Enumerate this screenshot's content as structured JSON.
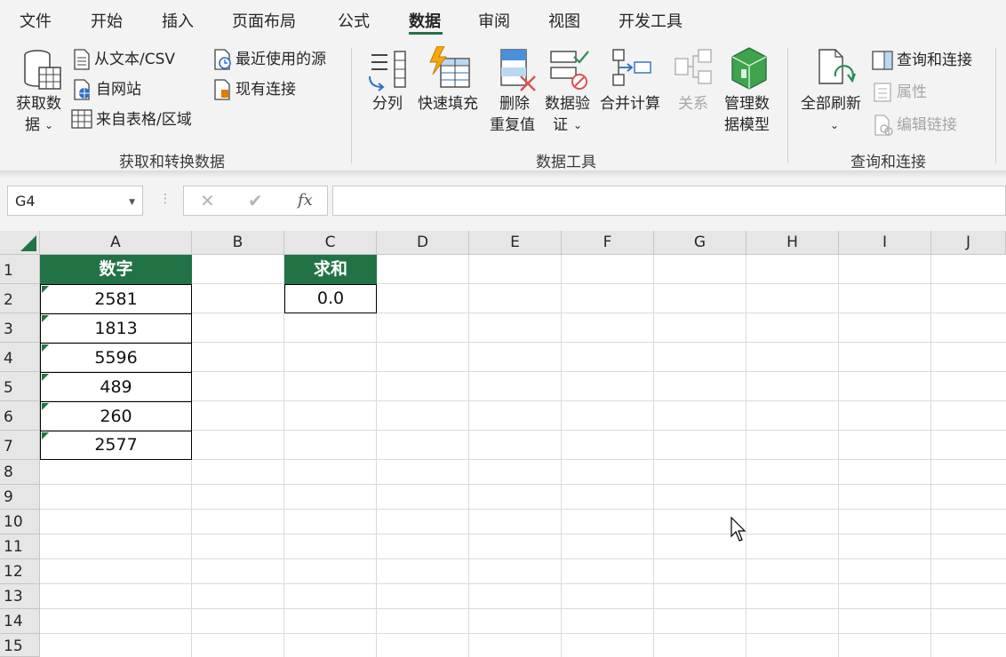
{
  "tabs": [
    {
      "label": "文件"
    },
    {
      "label": "开始"
    },
    {
      "label": "插入"
    },
    {
      "label": "页面布局"
    },
    {
      "label": "公式"
    },
    {
      "label": "数据"
    },
    {
      "label": "审阅"
    },
    {
      "label": "视图"
    },
    {
      "label": "开发工具"
    }
  ],
  "active_tab": "数据",
  "ribbon": {
    "get_data_line1": "获取数",
    "get_data_line2": "据",
    "from_text_csv": "从文本/CSV",
    "from_web": "自网站",
    "from_table": "来自表格/区域",
    "recent_sources": "最近使用的源",
    "existing_connections": "现有连接",
    "group_get_transform": "获取和转换数据",
    "text_to_columns": "分列",
    "flash_fill": "快速填充",
    "remove_dup_line1": "删除",
    "remove_dup_line2": "重复值",
    "data_validation_line1": "数据验",
    "data_validation_line2": "证",
    "consolidate": "合并计算",
    "relationships": "关系",
    "manage_model_line1": "管理数",
    "manage_model_line2": "据模型",
    "group_data_tools": "数据工具",
    "refresh_all": "全部刷新",
    "queries_connections": "查询和连接",
    "properties": "属性",
    "edit_links": "编辑链接",
    "group_queries": "查询和连接"
  },
  "formula_bar": {
    "name_box": "G4",
    "fx": "fx",
    "cancel": "✕",
    "enter": "✔",
    "formula": ""
  },
  "columns": [
    "A",
    "B",
    "C",
    "D",
    "E",
    "F",
    "G",
    "H",
    "I",
    "J"
  ],
  "rows": [
    "1",
    "2",
    "3",
    "4",
    "5",
    "6",
    "7",
    "8",
    "9",
    "10",
    "11",
    "12",
    "13",
    "14",
    "15"
  ],
  "sheet": {
    "a_header": "数字",
    "a_values": [
      "2581",
      "1813",
      "5596",
      "489",
      "260",
      "2577"
    ],
    "c_header": "求和",
    "c_value": "0.0"
  },
  "colors": {
    "accent": "#217346",
    "ribbon_bg": "#f3f3f3"
  }
}
